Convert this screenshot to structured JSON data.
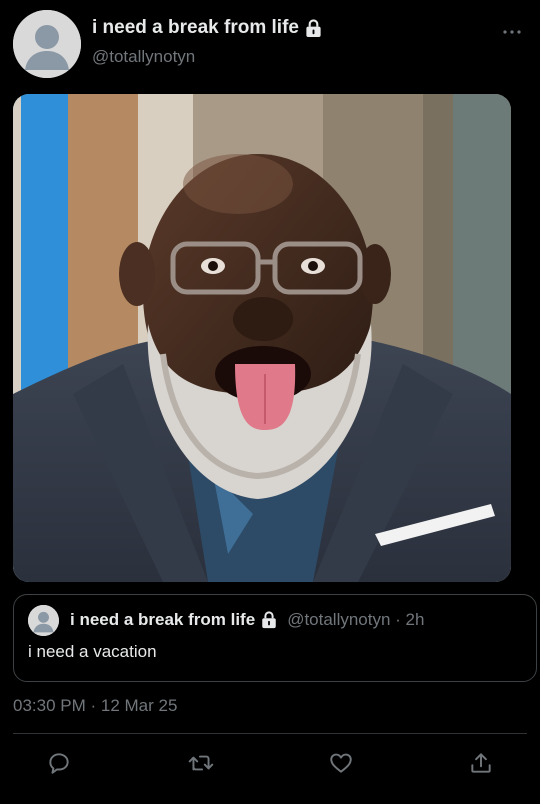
{
  "author": {
    "display_name": "i need a break from life",
    "handle": "@totallynotyn"
  },
  "quoted_tweet": {
    "display_name": "i need a break from life",
    "meta": "@totallynotyn · 2h",
    "text": "i need a vacation"
  },
  "timestamp": "03:30 PM · 12 Mar 25",
  "icons": {
    "more": "more-icon",
    "lock": "lock-icon",
    "reply": "reply-icon",
    "retweet": "retweet-icon",
    "like": "heart-icon",
    "share": "share-icon"
  },
  "colors": {
    "background": "#000000",
    "primary_text": "#e7e9ea",
    "secondary_text": "#71767b",
    "border": "#3e4144"
  }
}
